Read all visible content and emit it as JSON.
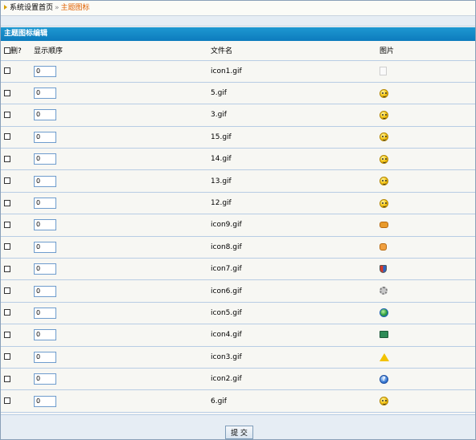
{
  "breadcrumb": {
    "home": "系统设置首页",
    "separator": "»",
    "current": "主题图标"
  },
  "header": {
    "title": "主题图标编辑"
  },
  "table": {
    "headers": {
      "delete": "删?",
      "order": "显示顺序",
      "filename": "文件名",
      "image": "图片"
    },
    "rows": [
      {
        "order": "0",
        "filename": "icon1.gif",
        "icon": "document-icon"
      },
      {
        "order": "0",
        "filename": "5.gif",
        "icon": "surprised-smiley-icon"
      },
      {
        "order": "0",
        "filename": "3.gif",
        "icon": "glasses-smiley-icon"
      },
      {
        "order": "0",
        "filename": "15.gif",
        "icon": "sad-smiley-icon"
      },
      {
        "order": "0",
        "filename": "14.gif",
        "icon": "wink-smiley-icon"
      },
      {
        "order": "0",
        "filename": "13.gif",
        "icon": "grin-smiley-icon"
      },
      {
        "order": "0",
        "filename": "12.gif",
        "icon": "smile-smiley-icon"
      },
      {
        "order": "0",
        "filename": "icon9.gif",
        "icon": "thumbs-down-icon"
      },
      {
        "order": "0",
        "filename": "icon8.gif",
        "icon": "thumbs-up-icon"
      },
      {
        "order": "0",
        "filename": "icon7.gif",
        "icon": "shield-icon"
      },
      {
        "order": "0",
        "filename": "icon6.gif",
        "icon": "gear-icon"
      },
      {
        "order": "0",
        "filename": "icon5.gif",
        "icon": "globe-icon"
      },
      {
        "order": "0",
        "filename": "icon4.gif",
        "icon": "monitor-icon"
      },
      {
        "order": "0",
        "filename": "icon3.gif",
        "icon": "warning-icon"
      },
      {
        "order": "0",
        "filename": "icon2.gif",
        "icon": "help-icon"
      },
      {
        "order": "0",
        "filename": "6.gif",
        "icon": "tongue-smiley-icon"
      }
    ]
  },
  "footer": {
    "submit_label": "提 交"
  },
  "colors": {
    "header_bg": "#1e98d1",
    "breadcrumb_current": "#e06000",
    "row_border": "#b8cde4"
  }
}
